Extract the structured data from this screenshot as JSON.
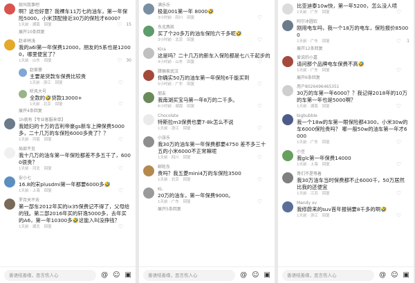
{
  "panels": [
    {
      "comments": [
        {
          "name": "就叫我事吧",
          "text": "啊？这也好意？我裸车11万七的油车，第一年保险5000，小米顶配接近30万的保险才6000?",
          "time": "1天前 · 湖南",
          "likes": "15",
          "color": "#d9534f"
        },
        {
          "expand": "展开10条回复"
        },
        {
          "name": "赵卓林浅",
          "text": "我的a6l第一年保费12000，朋友的5系也是12000，哪里便宜了？",
          "time": "1天前 · 山东",
          "likes": "30",
          "color": "#e2a92b"
        },
        {
          "name": "赵家豪",
          "text": "主要是贷款车保费比较贵",
          "time": "1天前 · 浙江",
          "likes": "",
          "color": "#7fa7d6",
          "indent": true
        },
        {
          "name": "听风大号",
          "text": "全款的🤣贷款13000+",
          "time": "1天前 · 北京",
          "likes": "",
          "color": "#9ab38a",
          "indent": true
        },
        {
          "expand": "展开4条回复"
        },
        {
          "name": "1h就有【专业客服来单】",
          "text": "我媳妇的十万的吉利帝豪gs新车上牌保费5000多，二十几万的车保险6000多贵了？？",
          "time": "1天前 · 河南",
          "likes": "",
          "color": "#6c7a89"
        },
        {
          "name": "局部不见",
          "text": "我十几万的油车第一年保险都差不多五千了，6000很贵？",
          "time": "1天前 · 河北",
          "likes": "",
          "color": "#f0f0f0"
        },
        {
          "name": "安小七",
          "text": "16.8的宋plusdmi第一年都要6000多🤣",
          "time": "1天前 · 上海",
          "likes": "",
          "color": "#5b8fbf"
        },
        {
          "name": "罗月关不去",
          "text": "第一部车2012年买的ix35保费记不得了，父母给的钱。第二部2016年买的轩逸5000多，去年买的A6，第一年10300多🤣这能入叫没挣钱？",
          "time": "1天前 · 湖北",
          "likes": "",
          "color": "#7a6a5a"
        }
      ],
      "input_placeholder": "善语结善缘，恶言伤人心"
    },
    {
      "comments": [
        {
          "name": "满乐乐",
          "text": "极氪001第一年 8000🤣",
          "time": "3小时前 · 四川",
          "likes": "",
          "color": "#7a8fa3"
        },
        {
          "name": "东北燕凯",
          "text": "买了个20多万的油车保险六千多呢🤣",
          "time": "3小时前 · 北京",
          "likes": "",
          "color": "#5e9c6b"
        },
        {
          "name": "Kira",
          "text": "这是吗？二十几万的新车入保险都是七八千起步的",
          "time": "4小时前 · 山东",
          "likes": "",
          "color": "#c0c0c0"
        },
        {
          "name": "腊猴家武汉",
          "text": "你确实50万的油车第一年保险6千能买到",
          "time": "5小时前 · 广东",
          "likes": "",
          "color": "#a34a3a"
        },
        {
          "name": "朋友",
          "text": "我南湖买宝马第一年8万的二千多。",
          "time": "6小时前 · 湖南",
          "likes": "",
          "color": "#6a8a5a"
        },
        {
          "name": "Chocolate",
          "text": "特斯拉m3保费也要7-8k怎么不说",
          "time": "1天前 · 浙江",
          "likes": "",
          "color": "#eaeaea"
        },
        {
          "name": "小张乐",
          "text": "我30万的油车第一年保费都要4750 差不多三十五的小米6000不正常嘛呢",
          "time": "1天前 · 四川",
          "likes": "",
          "color": "#8e8e8e"
        },
        {
          "name": "邮轮东",
          "text": "贵吗？我五菱mini4万的车保险3500",
          "time": "1天前 · 北京",
          "likes": "",
          "color": "#b5884d"
        },
        {
          "name": "KL",
          "text": "20万的油车，第一年保费9000。",
          "time": "1天前 · 广东",
          "likes": "",
          "color": "#9a9a9a"
        },
        {
          "expand": "展开5条回复"
        }
      ],
      "input_placeholder": "善语结善缘，恶言伤人心"
    },
    {
      "comments": [
        {
          "name": "",
          "text": "比亚迪泰10w快，第一年5200，怎么没人喷",
          "time": "1天前 · 广东",
          "likes": "",
          "color": "#dcdcdc"
        },
        {
          "name": "阿尔冰圆钦",
          "text": "刚用电车吗，我一个18万的电车，保险报价85000",
          "time": "1天前 · 广东",
          "likes": "1",
          "color": "#6b7b8b"
        },
        {
          "expand": "展开12条回复"
        },
        {
          "name": "爱说的小嘉",
          "text": "请问那个品牌电车保费不高🤣",
          "time": "1天前 · 广东",
          "likes": "",
          "color": "#a4493d"
        },
        {
          "expand": "展开6条回复"
        },
        {
          "name": "用户8026496465351",
          "text": "30万的车第一年6000？？我记得2018年的10万的车第一年也是5000啊？",
          "time": "1天前 · 湖南",
          "likes": "",
          "color": "#cfcfcf"
        },
        {
          "name": "bigbubble",
          "text": "我一个18w的车第一眼保险都4300，小米30w的车6000保险贵吗？ 哪一般50w的油车第一年才6000",
          "time": "1天前 · 广东",
          "likes": "",
          "color": "#4e5b8a"
        },
        {
          "name": "小豆",
          "text": "我glc第一年保费14000",
          "time": "1天前 · 上海",
          "likes": "",
          "color": "#67a05e"
        },
        {
          "name": "哥们不是等着",
          "text": "我30万油车当时保费都不止6000千，50万居然比我的还便宜",
          "time": "1天前 · 江苏",
          "likes": "",
          "color": "#7f7f7f"
        },
        {
          "name": "Mandy xv",
          "text": "我修蔚来的suv首年报销要8千多的啊🤣",
          "time": "1天前 · 浙江",
          "likes": "",
          "color": "#5a6e9a"
        }
      ],
      "input_placeholder": "善语结善缘，恶言伤人心"
    }
  ],
  "actions": {
    "reply": "回复",
    "heart_icon": "heart-icon"
  },
  "icons": [
    "at-icon",
    "emoji-icon",
    "image-icon"
  ]
}
